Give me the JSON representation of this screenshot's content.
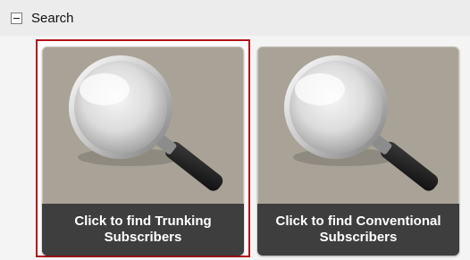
{
  "section": {
    "title": "Search",
    "collapse_icon": "minus-box-icon"
  },
  "tiles": [
    {
      "icon": "magnifying-glass-icon",
      "caption_line1": "Click to find Trunking",
      "caption_line2": "Subscribers",
      "selected": true
    },
    {
      "icon": "magnifying-glass-icon",
      "caption_line1": "Click to find Conventional",
      "caption_line2": "Subscribers",
      "selected": false
    }
  ],
  "colors": {
    "header_bg": "#ececec",
    "tile_bg": "#a9a397",
    "caption_bg": "#3e3e3e",
    "selection_border": "#b4121b"
  }
}
